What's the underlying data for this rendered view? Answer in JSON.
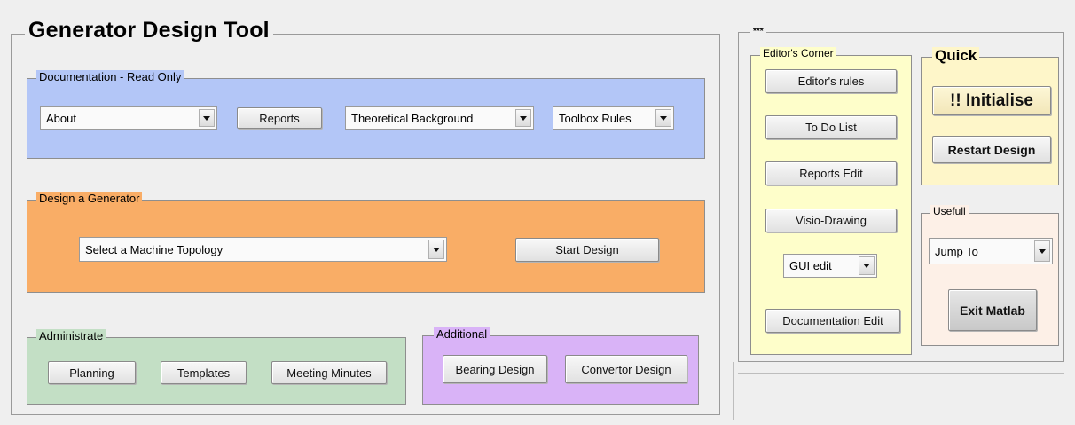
{
  "app": {
    "title": "Generator Design Tool"
  },
  "documentation": {
    "label": "Documentation - Read Only",
    "about_select": "About",
    "reports_button": "Reports",
    "theory_select": "Theoretical Background",
    "toolbox_select": "Toolbox Rules"
  },
  "design": {
    "label": "Design a Generator",
    "topology_select": "Select a Machine Topology",
    "start_button": "Start Design"
  },
  "administrate": {
    "label": "Administrate",
    "buttons": [
      "Planning",
      "Templates",
      "Meeting Minutes"
    ]
  },
  "additional": {
    "label": "Additional",
    "buttons": [
      "Bearing Design",
      "Convertor Design"
    ]
  },
  "side_panel": {
    "title": "***",
    "editors_corner": {
      "label": "Editor's Corner",
      "buttons": [
        "Editor's rules",
        "To Do List",
        "Reports Edit",
        "Visio-Drawing"
      ],
      "gui_select": "GUI edit",
      "doc_edit_button": "Documentation Edit"
    },
    "quick": {
      "label": "Quick",
      "initialise_button": "!! Initialise",
      "restart_button": "Restart Design"
    },
    "useful": {
      "label": "Usefull",
      "jump_select": "Jump To",
      "exit_button": "Exit Matlab"
    }
  },
  "colors": {
    "documentation_panel": "#b3c6f7",
    "design_panel": "#f9ad66",
    "administrate_panel": "#c3dfc5",
    "additional_panel": "#d9b3f7",
    "editors_panel": "#fefeca",
    "quick_panel": "#fef6c9",
    "useful_panel": "#fdf0e7"
  }
}
